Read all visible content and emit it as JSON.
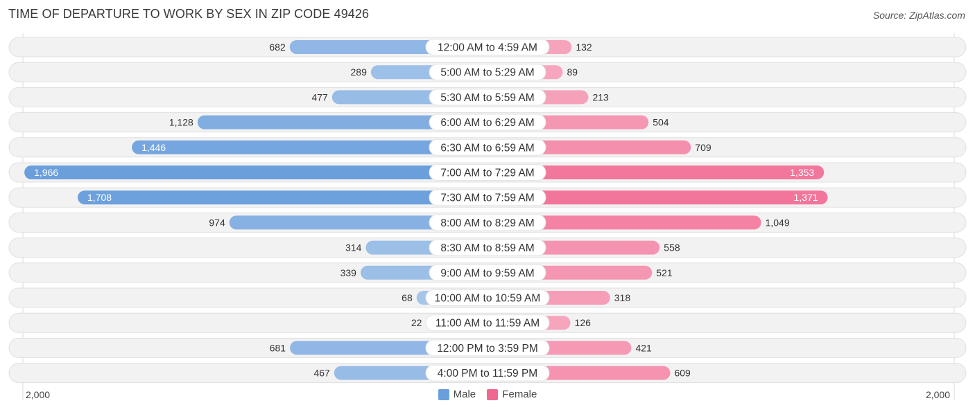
{
  "header": {
    "title": "TIME OF DEPARTURE TO WORK BY SEX IN ZIP CODE 49426",
    "source": "Source: ZipAtlas.com"
  },
  "legend": {
    "male_label": "Male",
    "female_label": "Female"
  },
  "axis": {
    "left_label": "2,000",
    "right_label": "2,000"
  },
  "colors": {
    "male": "#6a9fdc",
    "male_light": "#a7c6ea",
    "female": "#f06790",
    "female_light": "#f7a9c0",
    "row_bg": "#f2f2f2"
  },
  "chart_data": {
    "type": "bar",
    "orientation": "horizontal-diverging",
    "title": "TIME OF DEPARTURE TO WORK BY SEX IN ZIP CODE 49426",
    "xlim": [
      -2000,
      2000
    ],
    "legend_position": "bottom-center",
    "categories": [
      "12:00 AM to 4:59 AM",
      "5:00 AM to 5:29 AM",
      "5:30 AM to 5:59 AM",
      "6:00 AM to 6:29 AM",
      "6:30 AM to 6:59 AM",
      "7:00 AM to 7:29 AM",
      "7:30 AM to 7:59 AM",
      "8:00 AM to 8:29 AM",
      "8:30 AM to 8:59 AM",
      "9:00 AM to 9:59 AM",
      "10:00 AM to 10:59 AM",
      "11:00 AM to 11:59 AM",
      "12:00 PM to 3:59 PM",
      "4:00 PM to 11:59 PM"
    ],
    "series": [
      {
        "name": "Male",
        "values": [
          682,
          289,
          477,
          1128,
          1446,
          1966,
          1708,
          974,
          314,
          339,
          68,
          22,
          681,
          467
        ],
        "labels": [
          "682",
          "289",
          "477",
          "1,128",
          "1,446",
          "1,966",
          "1,708",
          "974",
          "314",
          "339",
          "68",
          "22",
          "681",
          "467"
        ]
      },
      {
        "name": "Female",
        "values": [
          132,
          89,
          213,
          504,
          709,
          1353,
          1371,
          1049,
          558,
          521,
          318,
          126,
          421,
          609
        ],
        "labels": [
          "132",
          "89",
          "213",
          "504",
          "709",
          "1,353",
          "1,371",
          "1,049",
          "558",
          "521",
          "318",
          "126",
          "421",
          "609"
        ]
      }
    ]
  }
}
